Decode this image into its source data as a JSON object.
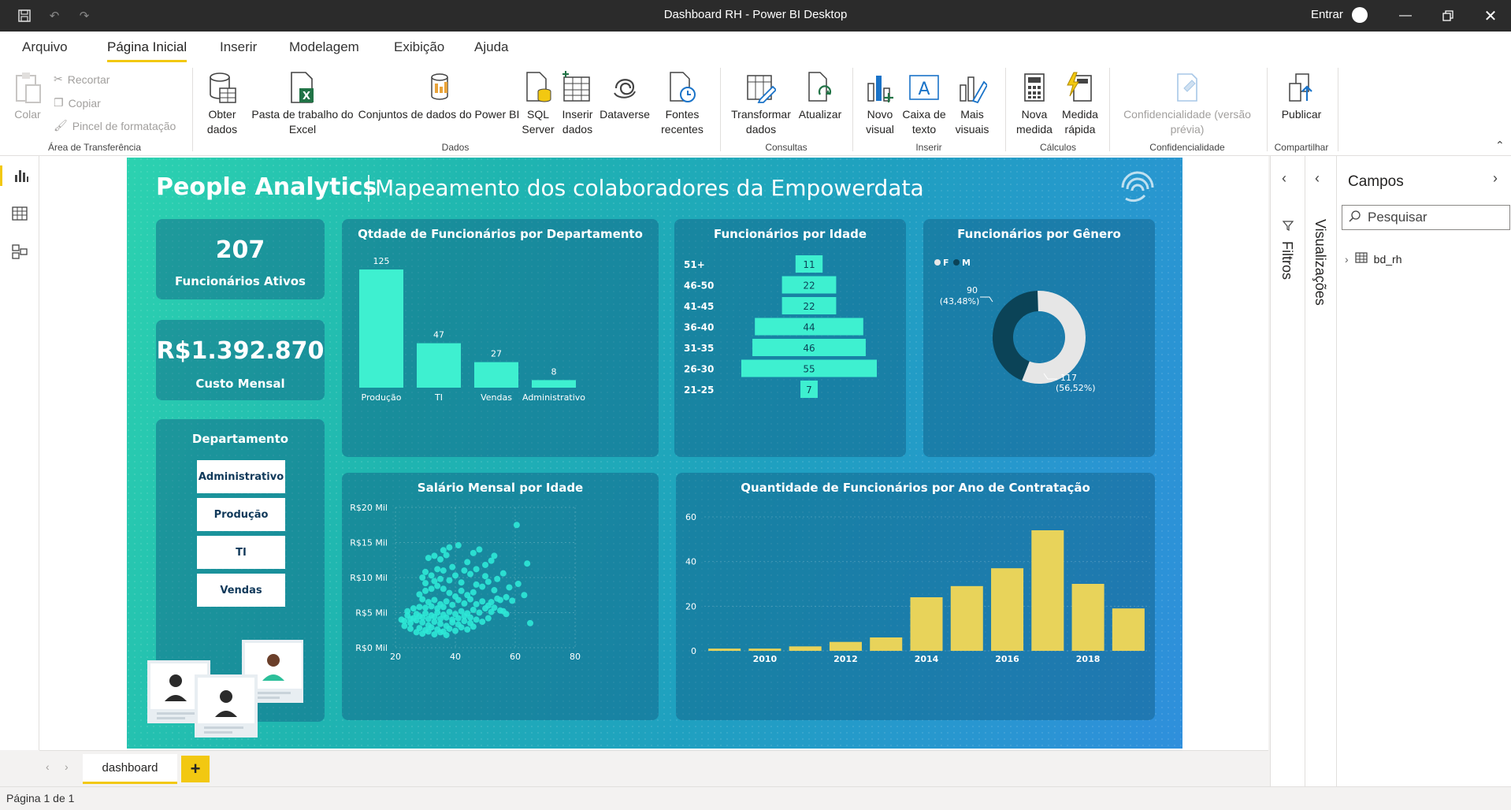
{
  "window": {
    "title": "Dashboard RH - Power BI Desktop",
    "sign_in": "Entrar"
  },
  "menu": {
    "tabs": [
      "Arquivo",
      "Página Inicial",
      "Inserir",
      "Modelagem",
      "Exibição",
      "Ajuda"
    ],
    "active_tab": "Página Inicial"
  },
  "ribbon": {
    "clipboard": {
      "paste": "Colar",
      "cut": "Recortar",
      "copy": "Copiar",
      "format_painter": "Pincel de formatação",
      "group": "Área de Transferência"
    },
    "data": {
      "get_data": "Obter dados",
      "excel": "Pasta de trabalho do Excel",
      "pbi_datasets": "Conjuntos de dados do Power BI",
      "sql": "SQL Server",
      "enter_data": "Inserir dados",
      "dataverse": "Dataverse",
      "recent": "Fontes recentes",
      "group": "Dados"
    },
    "queries": {
      "transform": "Transformar dados",
      "refresh": "Atualizar",
      "group": "Consultas"
    },
    "insert": {
      "new_visual": "Novo visual",
      "text_box": "Caixa de texto",
      "more_visuals": "Mais visuais",
      "group": "Inserir"
    },
    "calc": {
      "new_measure": "Nova medida",
      "quick_measure": "Medida rápida",
      "group": "Cálculos"
    },
    "sensitivity": {
      "label": "Confidencialidade (versão prévia)",
      "group": "Confidencialidade"
    },
    "share": {
      "publish": "Publicar",
      "group": "Compartilhar"
    }
  },
  "report": {
    "title": "People Analytics",
    "subtitle": "Mapeamento dos colaboradores da Empowerdata",
    "kpi_active": {
      "value": "207",
      "label": "Funcionários Ativos"
    },
    "kpi_cost": {
      "value": "R$1.392.870",
      "label": "Custo Mensal"
    },
    "slicer": {
      "title": "Departamento",
      "items": [
        "Administrativo",
        "Produção",
        "TI",
        "Vendas"
      ]
    },
    "dept_chart_title": "Qtdade de Funcionários por Departamento",
    "age_chart_title": "Funcionários por Idade",
    "gender_chart_title": "Funcionários por Gênero",
    "salary_chart_title": "Salário Mensal por Idade",
    "hire_chart_title": "Quantidade de Funcionários por Ano de Contratação"
  },
  "chart_data": [
    {
      "type": "bar",
      "title": "Qtdade de Funcionários por Departamento",
      "categories": [
        "Produção",
        "TI",
        "Vendas",
        "Administrativo"
      ],
      "values": [
        125,
        47,
        27,
        8
      ],
      "color": "#3ef0d0"
    },
    {
      "type": "bar",
      "title": "Funcionários por Idade",
      "orientation": "horizontal-centered",
      "categories": [
        "51+",
        "46-50",
        "41-45",
        "36-40",
        "31-35",
        "26-30",
        "21-25"
      ],
      "values": [
        11,
        22,
        22,
        44,
        46,
        55,
        7
      ],
      "color": "#3ef0d0"
    },
    {
      "type": "pie",
      "title": "Funcionários por Gênero",
      "variant": "donut",
      "legend": [
        {
          "label": "F",
          "color": "#e6e6e6"
        },
        {
          "label": "M",
          "color": "#0b4357"
        }
      ],
      "slices": [
        {
          "label": "M",
          "value": 90,
          "text": "90",
          "pct": "(43,48%)",
          "color": "#0b4357"
        },
        {
          "label": "F",
          "value": 117,
          "text": "117",
          "pct": "(56,52%)",
          "color": "#e6e6e6"
        }
      ]
    },
    {
      "type": "scatter",
      "title": "Salário Mensal por Idade",
      "x_ticks": [
        "20",
        "40",
        "60",
        "80"
      ],
      "y_ticks": [
        "R$0 Mil",
        "R$5 Mil",
        "R$10 Mil",
        "R$15 Mil",
        "R$20 Mil"
      ],
      "xlim": [
        20,
        80
      ],
      "ylim": [
        0,
        20000
      ],
      "color": "#2ee8d6",
      "points": [
        [
          60.5,
          17500
        ],
        [
          64,
          12000
        ],
        [
          65,
          3500
        ],
        [
          57,
          4800
        ],
        [
          56,
          5200
        ],
        [
          55,
          6800
        ],
        [
          52,
          12400
        ],
        [
          53,
          13100
        ],
        [
          50,
          11800
        ],
        [
          48,
          14000
        ],
        [
          46,
          13500
        ],
        [
          44,
          12200
        ],
        [
          41,
          14600
        ],
        [
          38,
          14300
        ],
        [
          37,
          13200
        ],
        [
          36,
          13900
        ],
        [
          35,
          12600
        ],
        [
          33,
          13100
        ],
        [
          31,
          12800
        ],
        [
          34,
          11200
        ],
        [
          32,
          10300
        ],
        [
          30,
          10800
        ],
        [
          29,
          10000
        ],
        [
          35,
          9800
        ],
        [
          38,
          9600
        ],
        [
          40,
          10300
        ],
        [
          42,
          9300
        ],
        [
          45,
          10500
        ],
        [
          47,
          9000
        ],
        [
          49,
          8700
        ],
        [
          51,
          9400
        ],
        [
          53,
          8200
        ],
        [
          46,
          7900
        ],
        [
          44,
          7500
        ],
        [
          42,
          8100
        ],
        [
          40,
          7300
        ],
        [
          38,
          7800
        ],
        [
          36,
          8400
        ],
        [
          34,
          8800
        ],
        [
          32,
          8400
        ],
        [
          30,
          8100
        ],
        [
          28,
          7600
        ],
        [
          29,
          6900
        ],
        [
          31,
          6500
        ],
        [
          33,
          6800
        ],
        [
          35,
          6200
        ],
        [
          37,
          6600
        ],
        [
          39,
          6100
        ],
        [
          41,
          6800
        ],
        [
          43,
          6300
        ],
        [
          45,
          6900
        ],
        [
          47,
          6200
        ],
        [
          49,
          6600
        ],
        [
          51,
          6000
        ],
        [
          53,
          5700
        ],
        [
          55,
          5300
        ],
        [
          52,
          5100
        ],
        [
          50,
          5600
        ],
        [
          48,
          5000
        ],
        [
          46,
          5400
        ],
        [
          44,
          4900
        ],
        [
          42,
          5200
        ],
        [
          40,
          4800
        ],
        [
          38,
          5100
        ],
        [
          36,
          4700
        ],
        [
          34,
          5000
        ],
        [
          32,
          4600
        ],
        [
          30,
          4900
        ],
        [
          28,
          4500
        ],
        [
          26,
          4200
        ],
        [
          24,
          4600
        ],
        [
          23,
          3800
        ],
        [
          25,
          3500
        ],
        [
          27,
          3900
        ],
        [
          29,
          3600
        ],
        [
          31,
          3200
        ],
        [
          33,
          3700
        ],
        [
          35,
          3400
        ],
        [
          37,
          3100
        ],
        [
          39,
          3600
        ],
        [
          41,
          3300
        ],
        [
          43,
          3800
        ],
        [
          45,
          3500
        ],
        [
          47,
          4000
        ],
        [
          49,
          3700
        ],
        [
          51,
          4200
        ],
        [
          28,
          2800
        ],
        [
          30,
          2500
        ],
        [
          32,
          2900
        ],
        [
          34,
          2600
        ],
        [
          36,
          2300
        ],
        [
          38,
          2700
        ],
        [
          40,
          2400
        ],
        [
          42,
          2900
        ],
        [
          44,
          2600
        ],
        [
          46,
          3000
        ],
        [
          25,
          2700
        ],
        [
          27,
          2200
        ],
        [
          29,
          2000
        ],
        [
          31,
          2300
        ],
        [
          33,
          1900
        ],
        [
          35,
          2200
        ],
        [
          37,
          1800
        ],
        [
          26,
          5600
        ],
        [
          28,
          5800
        ],
        [
          30,
          5700
        ],
        [
          32,
          5900
        ],
        [
          34,
          5600
        ],
        [
          36,
          5800
        ],
        [
          24,
          5200
        ],
        [
          22,
          4000
        ],
        [
          23,
          3100
        ],
        [
          25,
          4100
        ],
        [
          27,
          4800
        ],
        [
          29,
          4300
        ],
        [
          31,
          4100
        ],
        [
          33,
          4400
        ],
        [
          35,
          4100
        ],
        [
          37,
          4300
        ],
        [
          39,
          4000
        ],
        [
          41,
          4200
        ],
        [
          43,
          4500
        ],
        [
          45,
          4300
        ],
        [
          30,
          9200
        ],
        [
          33,
          9500
        ],
        [
          36,
          11000
        ],
        [
          39,
          11500
        ],
        [
          43,
          11000
        ],
        [
          47,
          11200
        ],
        [
          50,
          10200
        ],
        [
          54,
          9800
        ],
        [
          56,
          10600
        ],
        [
          58,
          8600
        ],
        [
          61,
          9100
        ],
        [
          63,
          7500
        ],
        [
          57,
          7200
        ],
        [
          54,
          7000
        ],
        [
          52,
          6500
        ],
        [
          59,
          6700
        ]
      ]
    },
    {
      "type": "bar",
      "title": "Quantidade de Funcionários por Ano de Contratação",
      "categories": [
        "2009",
        "2010",
        "2011",
        "2012",
        "2013",
        "2014",
        "2015",
        "2016",
        "2017",
        "2018",
        "2019"
      ],
      "x_tick_labels": [
        "2010",
        "2012",
        "2014",
        "2016",
        "2018"
      ],
      "values": [
        1,
        1,
        2,
        4,
        6,
        24,
        29,
        37,
        54,
        30,
        19
      ],
      "y_ticks": [
        "0",
        "20",
        "40",
        "60"
      ],
      "ylim": [
        0,
        60
      ],
      "color": "#e8d35a"
    }
  ],
  "canvas": {
    "page_tab": "dashboard"
  },
  "panes": {
    "filters": "Filtros",
    "visualizations": "Visualizações",
    "fields": {
      "title": "Campos",
      "search_placeholder": "Pesquisar",
      "tables": [
        "bd_rh"
      ]
    }
  },
  "status": {
    "page": "Página 1 de 1"
  }
}
